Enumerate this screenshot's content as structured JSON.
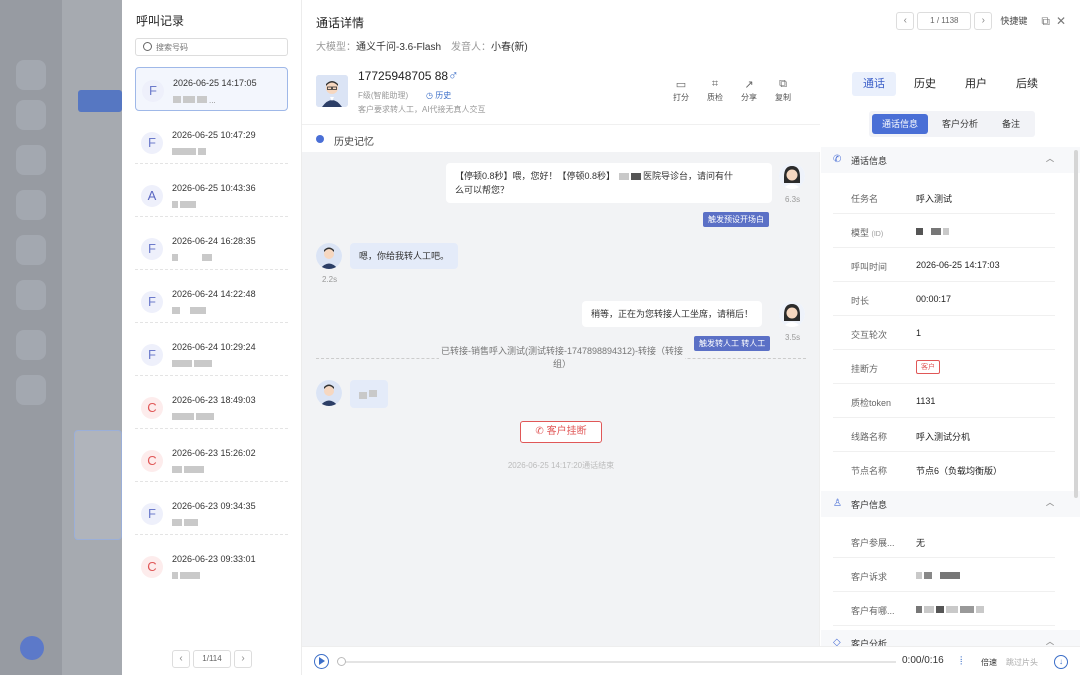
{
  "call_list": {
    "title": "呼叫记录",
    "search_placeholder": "搜索号码",
    "items": [
      {
        "avatar": "F",
        "time": "2026-06-25 14:17:05",
        "suffix": "..."
      },
      {
        "avatar": "F",
        "time": "2026-06-25 10:47:29",
        "suffix": ""
      },
      {
        "avatar": "A",
        "time": "2026-06-25 10:43:36",
        "suffix": ""
      },
      {
        "avatar": "F",
        "time": "2026-06-24 16:28:35",
        "suffix": ""
      },
      {
        "avatar": "F",
        "time": "2026-06-24 14:22:48",
        "suffix": ""
      },
      {
        "avatar": "F",
        "time": "2026-06-24 10:29:24",
        "suffix": ""
      },
      {
        "avatar": "C",
        "time": "2026-06-23 18:49:03",
        "suffix": ""
      },
      {
        "avatar": "C",
        "time": "2026-06-23 15:26:02",
        "suffix": ""
      },
      {
        "avatar": "F",
        "time": "2026-06-23 09:34:35",
        "suffix": ""
      },
      {
        "avatar": "C",
        "time": "2026-06-23 09:33:01",
        "suffix": ""
      }
    ],
    "pager": {
      "prev": "‹",
      "value": "1/114",
      "next": "›"
    }
  },
  "detail": {
    "title": "通话详情",
    "model_label": "大模型：",
    "model_value": "通义千问-3.6-Flash",
    "speaker_label": "发音人：",
    "speaker_value": "小春(新)",
    "pager_value": "1 / 1138",
    "shortcut": "快捷键"
  },
  "contact": {
    "phone": "17725948705 88",
    "level": "F级(智能助理)",
    "history_link": "历史",
    "request": "客户要求转人工，AI代接无真人交互",
    "actions": [
      {
        "icon": "comment-icon",
        "label": "打分"
      },
      {
        "icon": "scan-icon",
        "label": "质检"
      },
      {
        "icon": "share-icon",
        "label": "分享"
      },
      {
        "icon": "copy-icon",
        "label": "复制"
      }
    ],
    "memory": "历史记忆"
  },
  "messages": {
    "m1": "【停顿0.8秒】喂，您好！【停顿0.8秒】",
    "m1b": "医院导诊台，请问有什",
    "m1c": "么可以帮您？",
    "m1_tag": "触发预设开场白",
    "m1_dur": "6.3s",
    "m2": "嗯，你给我转人工吧。",
    "m2_dur": "2.2s",
    "m3": "稍等，正在为您转接人工坐席，请稍后！",
    "m3_tag": "触发转人工 转人工",
    "m3_dur": "3.5s",
    "transfer": "已转接-销售呼入测试(测试转接-1747898894312)-转接（转接组）",
    "hangup": "客户挂断",
    "end_time": "2026-06-25 14:17:20通话结束"
  },
  "player": {
    "time": "0:00/0:16",
    "speed": "倍速",
    "skip": "跳过片头",
    "progress": 0
  },
  "right_panel": {
    "tabs": [
      "通话",
      "历史",
      "用户",
      "后续"
    ],
    "subtabs": [
      "通话信息",
      "客户分析",
      "备注"
    ],
    "sec_call": "通话信息",
    "call_rows": [
      {
        "k": "任务名",
        "v": "呼入测试"
      },
      {
        "k": "模型",
        "k2": "(ID)",
        "v": ""
      },
      {
        "k": "呼叫时间",
        "v": "2026-06-25 14:17:03"
      },
      {
        "k": "时长",
        "v": "00:00:17"
      },
      {
        "k": "交互轮次",
        "v": "1"
      },
      {
        "k": "挂断方",
        "v": "客户"
      },
      {
        "k": "质检token",
        "v": "1131"
      },
      {
        "k": "线路名称",
        "v": "呼入测试分机"
      },
      {
        "k": "节点名称",
        "v": "节点6（负载均衡版）"
      }
    ],
    "sec_customer": "客户信息",
    "customer_rows": [
      {
        "k": "客户参展...",
        "v": "无"
      },
      {
        "k": "客户诉求",
        "v": ""
      },
      {
        "k": "客户有哪...",
        "v": ""
      }
    ],
    "sec_analysis": "客户分析"
  },
  "colors": {
    "accent": "#3b6ec8",
    "danger": "#e05757",
    "tag": "#5b70c6"
  }
}
